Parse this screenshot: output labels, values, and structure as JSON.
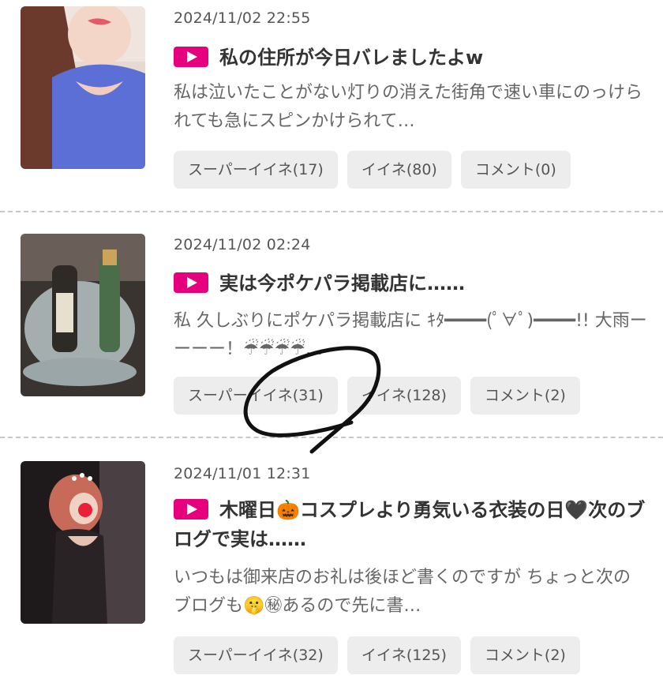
{
  "posts": [
    {
      "date": "2024/11/02 22:55",
      "title": "私の住所が今日バレましたよw",
      "excerpt": "私は泣いたことがない灯りの消えた街角で速い車にのっけられても急にスピンかけられて…",
      "buttons": {
        "super_like": "スーパーイイネ(17)",
        "like": "イイネ(80)",
        "comment": "コメント(0)"
      },
      "image": "photo-woman-blue-top"
    },
    {
      "date": "2024/11/02 02:24",
      "title": "実は今ポケパラ掲載店に……",
      "excerpt": " 私 久しぶりにポケパラ掲載店に ｷﾀ━━━━(ﾟ∀ﾟ)━━━━!! 大雨ーーーー！☔☔☔☔…",
      "buttons": {
        "super_like": "スーパーイイネ(31)",
        "like": "イイネ(128)",
        "comment": "コメント(2)"
      },
      "image": "photo-champagne-bucket"
    },
    {
      "date": "2024/11/01 12:31",
      "title": "木曜日🎃コスプレより勇気いる衣装の日🖤次のブログで実は……",
      "excerpt": " いつもは御来店のお礼は後ほど書くのですが ちょっと次のブログも🤫㊙あるので先に書…",
      "buttons": {
        "super_like": "スーパーイイネ(32)",
        "like": "イイネ(125)",
        "comment": "コメント(2)"
      },
      "image": "photo-woman-black-dress"
    }
  ],
  "colors": {
    "accent": "#e6007e",
    "button_bg": "#ededed",
    "scribble": "#111111"
  }
}
